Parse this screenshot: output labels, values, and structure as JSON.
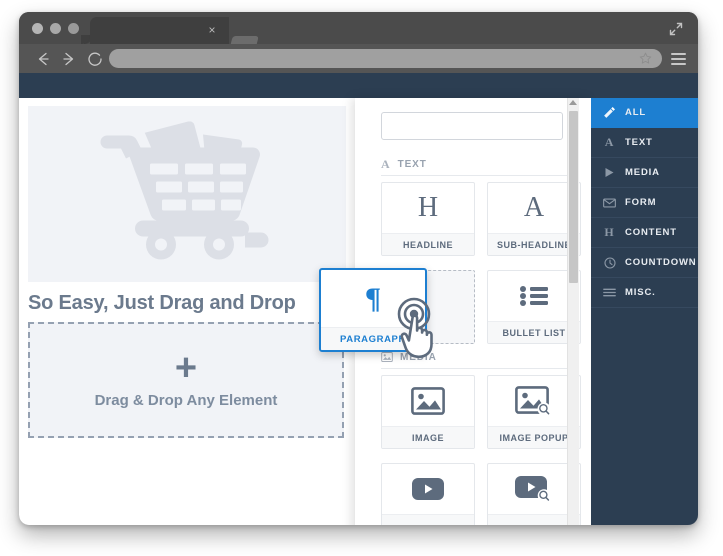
{
  "browser": {
    "tab_close_label": "×",
    "nav": {
      "back_icon": "arrow-left-icon",
      "forward_icon": "arrow-right-icon",
      "reload_icon": "reload-icon"
    },
    "address_value": "",
    "bookmark_icon": "star-icon",
    "menu_icon": "hamburger-menu-icon",
    "expand_icon": "expand-arrows-icon"
  },
  "canvas": {
    "hero_icon": "shopping-cart-icon",
    "headline": "So Easy, Just Drag and Drop",
    "dropzone": {
      "plus": "+",
      "label": "Drag & Drop Any Element"
    }
  },
  "panel": {
    "search_value": "",
    "search_placeholder": "",
    "sections": [
      {
        "key": "text",
        "label": "TEXT",
        "icon": "serif-a-icon",
        "cards": [
          {
            "label": "HEADLINE",
            "icon": "serif-h-icon",
            "placeholder": false
          },
          {
            "label": "SUB-HEADLINE",
            "icon": "serif-a-icon",
            "placeholder": false
          },
          {
            "label": "",
            "icon": "",
            "placeholder": true
          },
          {
            "label": "BULLET LIST",
            "icon": "bullet-list-icon",
            "placeholder": false
          }
        ]
      },
      {
        "key": "media",
        "label": "MEDIA",
        "icon": "image-icon",
        "cards": [
          {
            "label": "IMAGE",
            "icon": "image-icon",
            "placeholder": false
          },
          {
            "label": "IMAGE POPUP",
            "icon": "image-search-icon",
            "placeholder": false
          },
          {
            "label": "",
            "icon": "video-icon",
            "placeholder": false
          },
          {
            "label": "",
            "icon": "video-search-icon",
            "placeholder": false
          }
        ]
      }
    ]
  },
  "categories": [
    {
      "label": "ALL",
      "icon": "magic-wand-icon",
      "active": true
    },
    {
      "label": "TEXT",
      "icon": "serif-a-icon",
      "active": false
    },
    {
      "label": "MEDIA",
      "icon": "play-icon",
      "active": false
    },
    {
      "label": "FORM",
      "icon": "envelope-icon",
      "active": false
    },
    {
      "label": "CONTENT",
      "icon": "serif-h-icon",
      "active": false
    },
    {
      "label": "COUNTDOWN",
      "icon": "clock-icon",
      "active": false
    },
    {
      "label": "MISC.",
      "icon": "lines-icon",
      "active": false
    }
  ],
  "drag": {
    "label": "PARAGRAPH",
    "icon": "pilcrow-icon",
    "cursor": "pointing-hand-cursor"
  },
  "colors": {
    "accent": "#1d7fd1",
    "sidebar_bg": "#2c3e52",
    "text_muted": "#6b7a8d",
    "canvas_placeholder": "#f1f3f7"
  }
}
